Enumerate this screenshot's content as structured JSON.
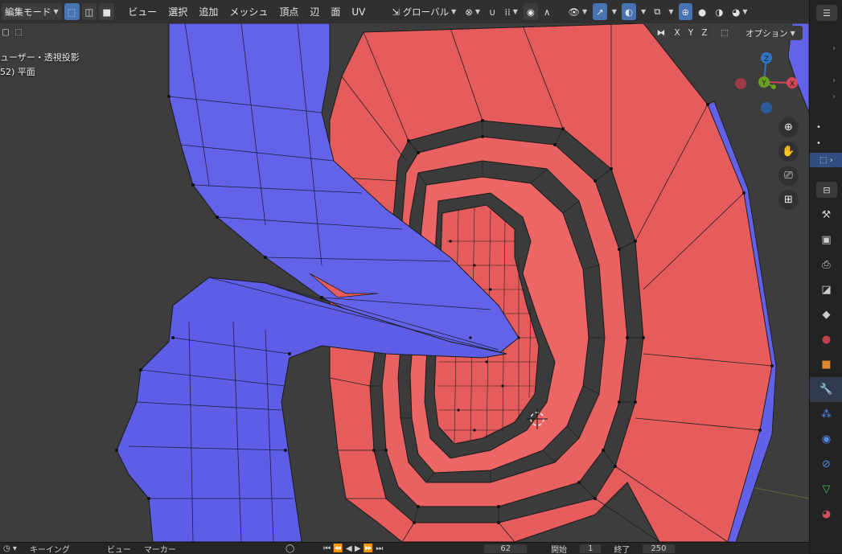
{
  "header": {
    "mode_label": "編集モード",
    "menus": [
      "ビュー",
      "選択",
      "追加",
      "メッシュ",
      "頂点",
      "辺",
      "面",
      "UV"
    ],
    "transform_orientation": "グローバル"
  },
  "viewport": {
    "view_name": "ューザー・透視投影",
    "object_info": "52) 平面",
    "axis_x": "X",
    "axis_y": "Y",
    "axis_z": "Z",
    "options_label": "オプション"
  },
  "gizmo": {
    "x": "X",
    "y": "Y",
    "z": "Z"
  },
  "timeline": {
    "playback_label": "キーイング",
    "view_label": "ビュー",
    "marker_label": "マーカー",
    "current_frame": "62",
    "start_label": "開始",
    "start_value": "1",
    "end_label": "終了",
    "end_value": "250"
  },
  "colors": {
    "blue_mesh": "#6262e8",
    "red_mesh": "#e65c5c",
    "header_active": "#4772b3",
    "viewport_bg": "#3d3d3d"
  },
  "icons": [
    "select-box-icon",
    "vertex-select-icon",
    "edge-select-icon",
    "face-select-icon",
    "orientation-icon",
    "pivot-icon",
    "snap-icon",
    "snap-target-icon",
    "proportional-icon",
    "falloff-icon",
    "visibility-icon",
    "gizmo-icon",
    "overlay-icon",
    "xray-icon",
    "wireframe-shading-icon",
    "solid-shading-icon",
    "material-shading-icon",
    "rendered-shading-icon",
    "zoom-icon",
    "hand-icon",
    "camera-icon",
    "grid-icon",
    "tool-icon",
    "render-icon",
    "output-icon",
    "view-layer-icon",
    "scene-icon",
    "world-icon",
    "object-icon",
    "modifier-icon",
    "particles-icon",
    "physics-icon",
    "constraints-icon",
    "data-icon",
    "material-icon"
  ]
}
